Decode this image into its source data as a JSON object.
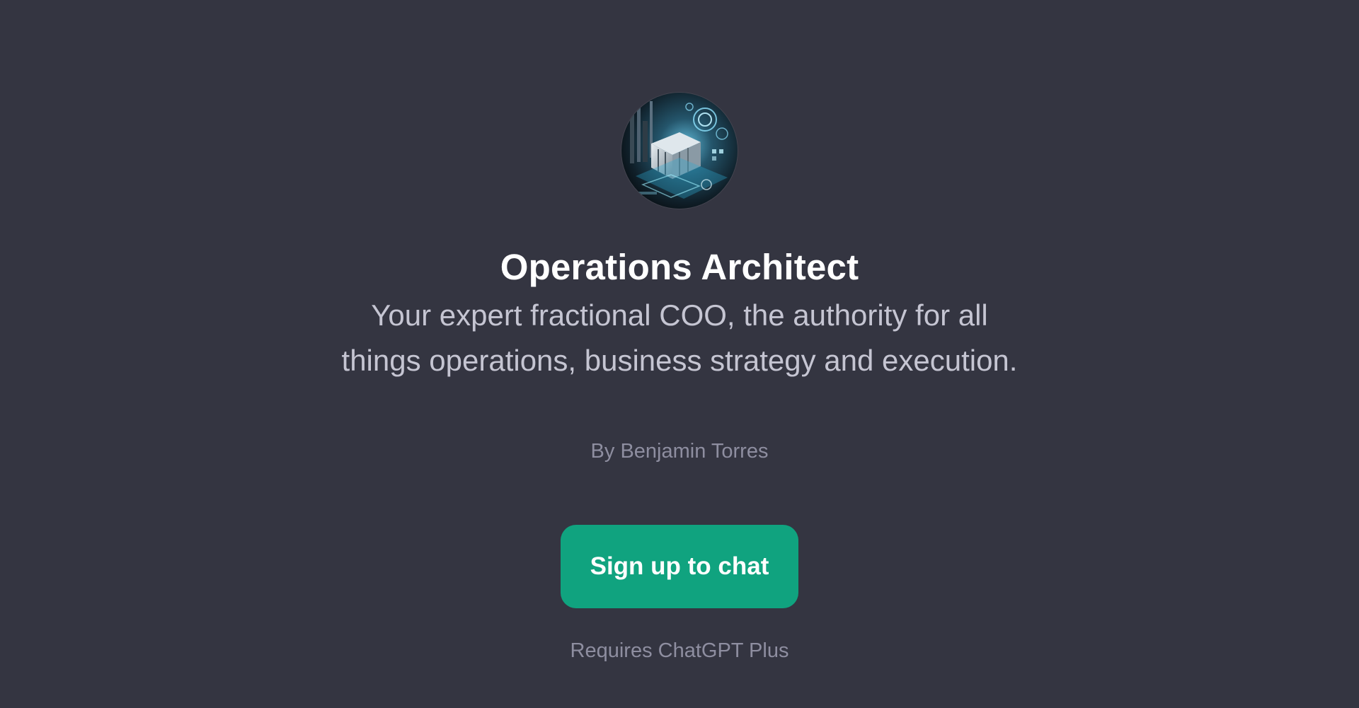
{
  "gpt": {
    "avatar_icon": "operations-architecture-avatar",
    "title": "Operations Architect",
    "description": "Your expert fractional COO, the authority for all things operations, business strategy and execution.",
    "author": "By Benjamin Torres"
  },
  "actions": {
    "signup_label": "Sign up to chat"
  },
  "footer": {
    "requirement": "Requires ChatGPT Plus"
  },
  "colors": {
    "background": "#343541",
    "accent": "#10a37f",
    "title": "#ffffff",
    "description": "#c5c5d2",
    "muted": "#8e8ea0"
  }
}
